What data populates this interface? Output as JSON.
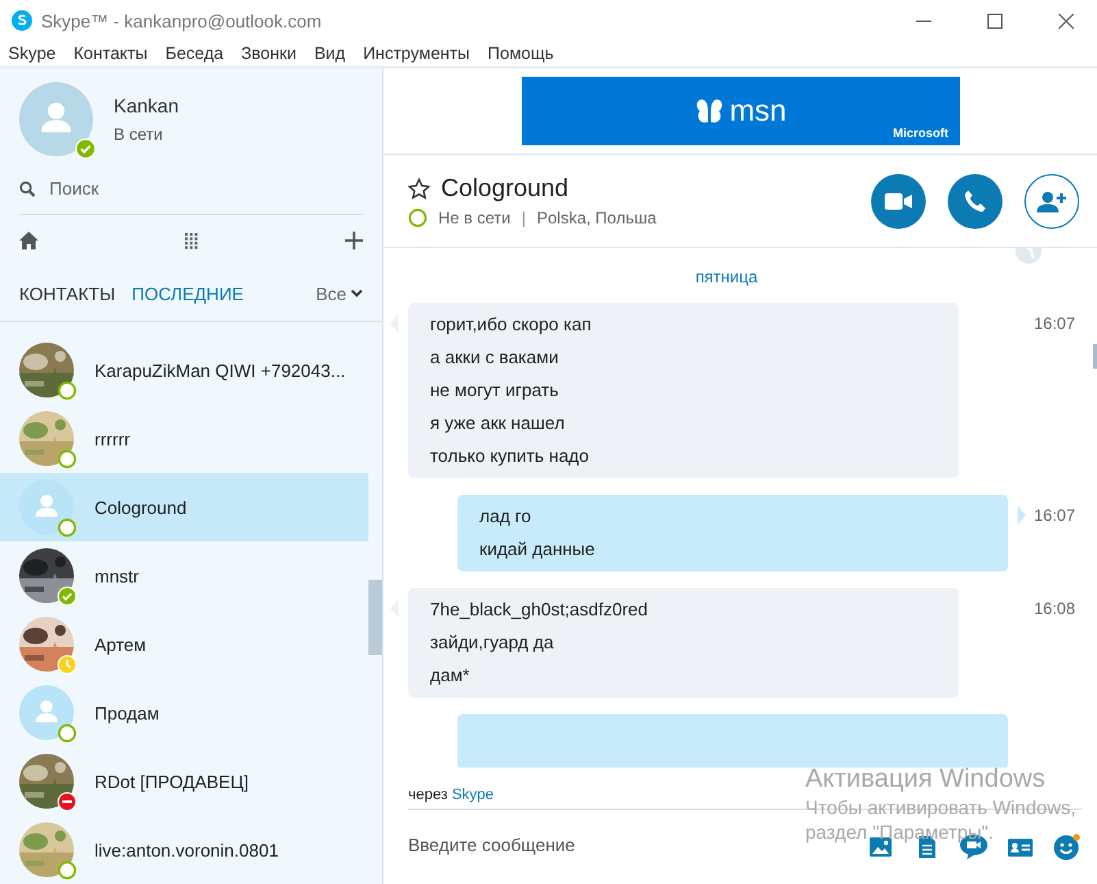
{
  "window": {
    "title": "Skype™ - kankanpro@outlook.com"
  },
  "menu": [
    "Skype",
    "Контакты",
    "Беседа",
    "Звонки",
    "Вид",
    "Инструменты",
    "Помощь"
  ],
  "profile": {
    "name": "Kankan",
    "status": "В сети",
    "presence": {
      "kind": "online"
    }
  },
  "search": {
    "placeholder": "Поиск"
  },
  "list_tabs": [
    {
      "label": "КОНТАКТЫ",
      "selected": false
    },
    {
      "label": "ПОСЛЕДНИЕ",
      "selected": true
    }
  ],
  "filter": {
    "label": "Все"
  },
  "contacts": [
    {
      "name": "KarapuZikMan QIWI +792043...",
      "presence": {
        "kind": "offline"
      },
      "selected": false
    },
    {
      "name": "rrrrrr",
      "presence": {
        "kind": "offline"
      },
      "selected": false
    },
    {
      "name": "Cologround",
      "presence": {
        "kind": "offline"
      },
      "avatar": {
        "kind": "silhouette"
      },
      "selected": true
    },
    {
      "name": "mnstr",
      "presence": {
        "kind": "online"
      },
      "selected": false
    },
    {
      "name": "Артем",
      "presence": {
        "kind": "away"
      },
      "selected": false
    },
    {
      "name": "Продам",
      "presence": {
        "kind": "offline"
      },
      "avatar": {
        "kind": "silhouette"
      },
      "selected": false
    },
    {
      "name": "RDot [ПРОДАВЕЦ]",
      "presence": {
        "kind": "busy"
      },
      "selected": false
    },
    {
      "name": "live:anton.voronin.0801",
      "presence": {
        "kind": "offline"
      },
      "selected": false
    }
  ],
  "ad": {
    "logo": "msn",
    "brand": "Microsoft"
  },
  "conversation": {
    "name": "Cologround",
    "favorite": false,
    "presence": {
      "kind": "offline"
    },
    "status": "Не в сети",
    "separator": "|",
    "location": "Polska, Польша"
  },
  "day_label": "пятница",
  "messages": [
    {
      "kind": "incoming",
      "time": "16:07",
      "lines": [
        "горит,ибо скоро кап",
        "а акки с ваками",
        "не могут играть",
        "я уже акк нашел",
        "только купить надо"
      ]
    },
    {
      "kind": "outgoing",
      "time": "16:07",
      "lines": [
        "лад го",
        "кидай данные"
      ]
    },
    {
      "kind": "incoming",
      "time": "16:08",
      "lines": [
        "7he_black_gh0st;asdfz0red",
        "зайди,гуард да",
        "дам*"
      ]
    },
    {
      "kind": "outgoing"
    }
  ],
  "via": {
    "prefix": "через",
    "service": "Skype"
  },
  "compose": {
    "placeholder": "Введите сообщение"
  },
  "activation_notice": {
    "title": "Активация Windows",
    "lines": [
      "Чтобы активировать Windows,",
      "раздел \"Параметры\"."
    ]
  }
}
